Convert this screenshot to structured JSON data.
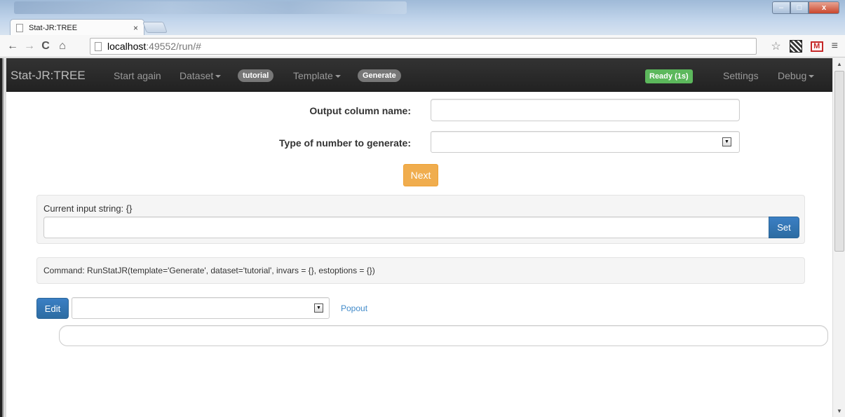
{
  "browser": {
    "tab_title": "Stat-JR:TREE",
    "tab_close": "×",
    "url_host": "localhost",
    "url_rest": ":49552/run/#",
    "win_minimize": "–",
    "win_maximize": "□",
    "win_close": "x",
    "nav_back": "←",
    "nav_forward": "→",
    "nav_reload": "C",
    "nav_home": "⌂",
    "star": "☆",
    "menu": "≡"
  },
  "navbar": {
    "brand": "Stat-JR:TREE",
    "start_again": "Start again",
    "dataset": "Dataset",
    "dataset_badge": "tutorial",
    "template": "Template",
    "template_badge": "Generate",
    "status": "Ready (1s)",
    "settings": "Settings",
    "debug": "Debug"
  },
  "form": {
    "output_label": "Output column name:",
    "output_value": "",
    "type_label": "Type of number to generate:",
    "type_value": "",
    "next_button": "Next"
  },
  "input_well": {
    "label": "Current input string: {}",
    "value": "",
    "set_button": "Set"
  },
  "command_well": {
    "text": "Command: RunStatJR(template='Generate', dataset='tutorial', invars = {}, estoptions = {})"
  },
  "edit_bar": {
    "edit_button": "Edit",
    "select_value": "",
    "popout_link": "Popout"
  },
  "icons": {
    "dropdown_arrow": "▼",
    "scroll_up": "▲",
    "scroll_down": "▼"
  }
}
